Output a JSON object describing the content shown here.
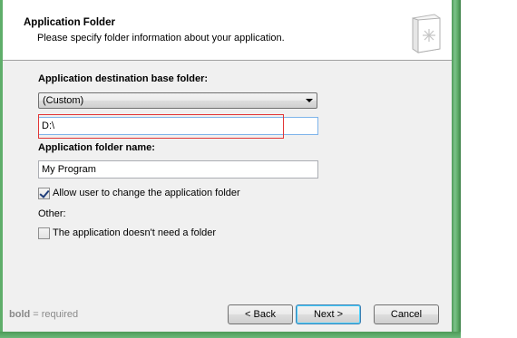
{
  "header": {
    "title": "Application Folder",
    "subtitle": "Please specify folder information about your application.",
    "icon": "folder-document-icon"
  },
  "form": {
    "base_folder_label": "Application destination base folder:",
    "base_folder_selected": "(Custom)",
    "base_folder_path": "D:\\",
    "folder_name_label": "Application folder name:",
    "folder_name_value": "My Program",
    "allow_change_label": "Allow user to change the application folder",
    "allow_change_checked": true,
    "other_label": "Other:",
    "no_folder_label": "The application doesn't need a folder",
    "no_folder_checked": false
  },
  "footer": {
    "bold_word": "bold",
    "note_rest": " = required",
    "back_label": "< Back",
    "next_label": "Next >",
    "cancel_label": "Cancel"
  },
  "colors": {
    "highlight_rect": "#e23636",
    "window_frame": "#5aa964"
  }
}
